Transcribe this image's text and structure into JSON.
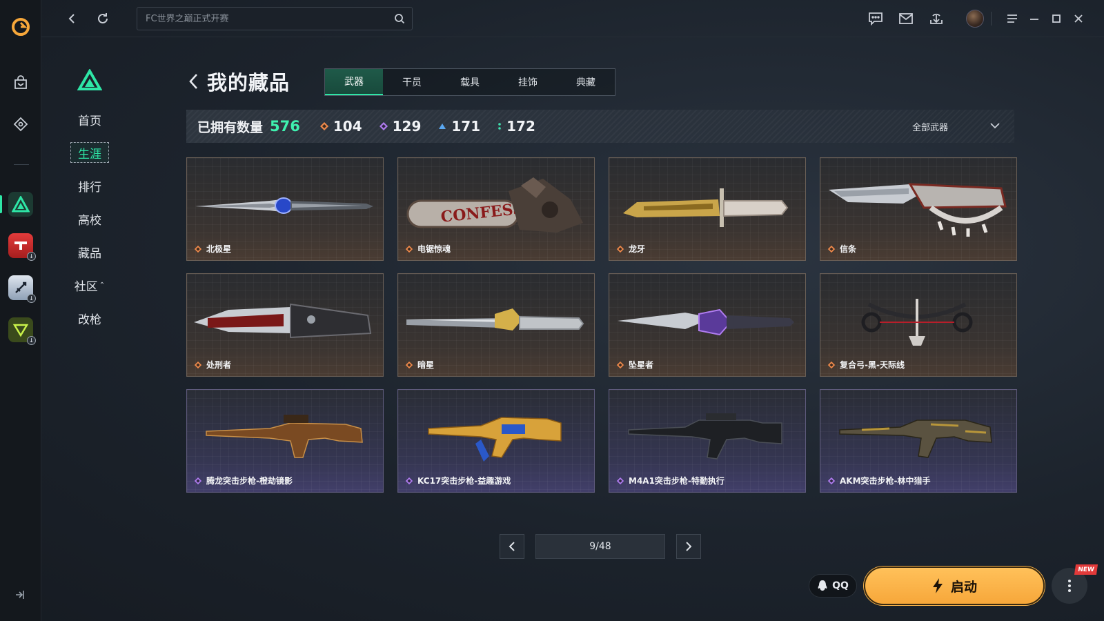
{
  "window": {
    "search_placeholder": "FC世界之巅正式开赛"
  },
  "nav": {
    "items": [
      {
        "label": "首页"
      },
      {
        "label": "生涯",
        "active": true
      },
      {
        "label": "排行"
      },
      {
        "label": "高校"
      },
      {
        "label": "藏品"
      },
      {
        "label": "社区"
      },
      {
        "label": "改枪"
      }
    ]
  },
  "header": {
    "title": "我的藏品",
    "tabs": [
      {
        "label": "武器",
        "active": true
      },
      {
        "label": "干员"
      },
      {
        "label": "载具"
      },
      {
        "label": "挂饰"
      },
      {
        "label": "典藏"
      }
    ]
  },
  "stats": {
    "owned_label": "已拥有数量",
    "owned_count": "576",
    "rarities": [
      {
        "color": "#f08a4b",
        "value": "104"
      },
      {
        "color": "#b07cf0",
        "value": "129"
      },
      {
        "color": "#5aa7f0",
        "value": "171"
      },
      {
        "color": "#3fe2b0",
        "value": "172"
      }
    ],
    "filter_label": "全部武器"
  },
  "items": [
    {
      "name": "北极星",
      "rarity": "gold",
      "icon": "knife-icon"
    },
    {
      "name": "电锯惊魂",
      "rarity": "gold",
      "icon": "chainsaw-icon"
    },
    {
      "name": "龙牙",
      "rarity": "gold",
      "icon": "bayonet-icon"
    },
    {
      "name": "信条",
      "rarity": "gold",
      "icon": "knuckle-knife-icon"
    },
    {
      "name": "处刑者",
      "rarity": "gold",
      "icon": "serrated-knife-icon"
    },
    {
      "name": "暗星",
      "rarity": "gold",
      "icon": "blade-icon"
    },
    {
      "name": "坠星者",
      "rarity": "gold",
      "icon": "long-blade-icon"
    },
    {
      "name": "复合弓-黑-天际线",
      "rarity": "gold",
      "icon": "compound-bow-icon"
    },
    {
      "name": "腾龙突击步枪-橙劫镜影",
      "rarity": "purple",
      "icon": "rifle-icon"
    },
    {
      "name": "KC17突击步枪-益趣游戏",
      "rarity": "purple",
      "icon": "rifle-icon"
    },
    {
      "name": "M4A1突击步枪-特勤执行",
      "rarity": "purple",
      "icon": "rifle-icon"
    },
    {
      "name": "AKM突击步枪-林中猎手",
      "rarity": "purple",
      "icon": "rifle-icon"
    }
  ],
  "pagination": {
    "text": "9/48"
  },
  "footer": {
    "qq_label": "QQ",
    "launch_label": "启动",
    "new_badge": "NEW"
  },
  "colors": {
    "accent": "#2ee6a6",
    "launch": "#f7a73a",
    "gold_diamond": "#f08a4b",
    "purple_diamond": "#b07cf0"
  }
}
